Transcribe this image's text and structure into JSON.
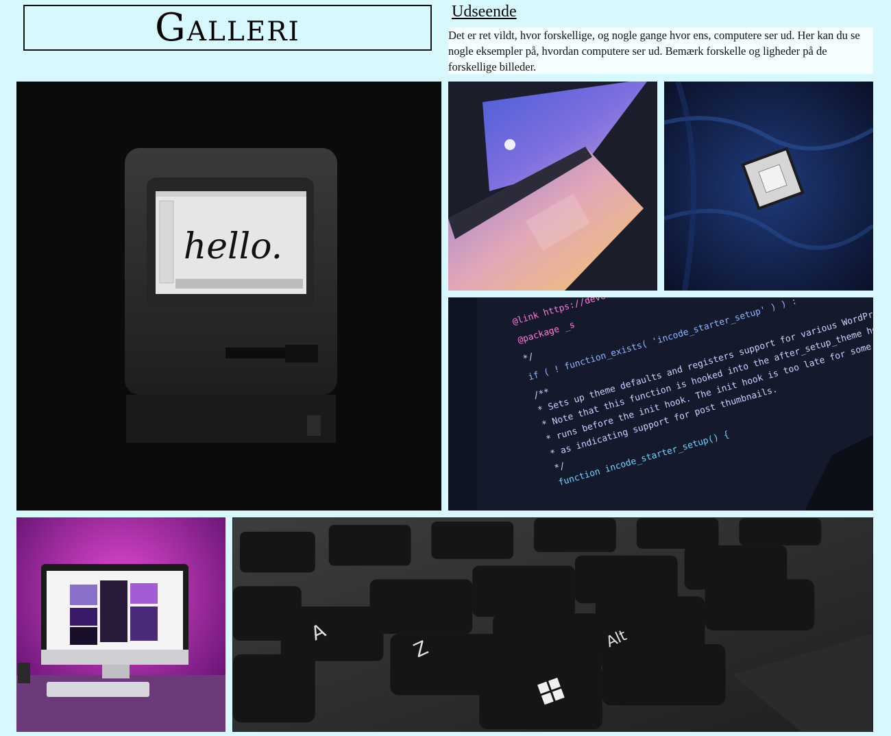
{
  "page": {
    "title": "Galleri",
    "heading": "Udseende",
    "description": "Det er ret vildt, hvor forskellige, og nogle gange hvor ens, computere ser ud. Her kan du se nogle eksempler på, hvordan computere ser ud. Bemærk forskelle og ligheder på de forskellige billeder."
  },
  "gallery": {
    "mac_screen_text": "hello.",
    "code_lines": [
      "@link https://devel",
      "@package _s",
      "*/",
      "if ( ! function_exists( 'incode_starter_setup' ) ) :",
      "/**",
      " * Sets up theme defaults and registers support for various WordPress features.",
      " * Note that this function is hooked into the after_setup_theme hook, which",
      " * runs before the init hook. The init hook is too late for some features,",
      " * as indicating support for post thumbnails.",
      " */",
      "function incode_starter_setup() {"
    ],
    "keyboard_keys": [
      "A",
      "Z",
      "Alt"
    ]
  },
  "colors": {
    "background": "#d7f9fd",
    "description_bg": "#f4feff"
  }
}
